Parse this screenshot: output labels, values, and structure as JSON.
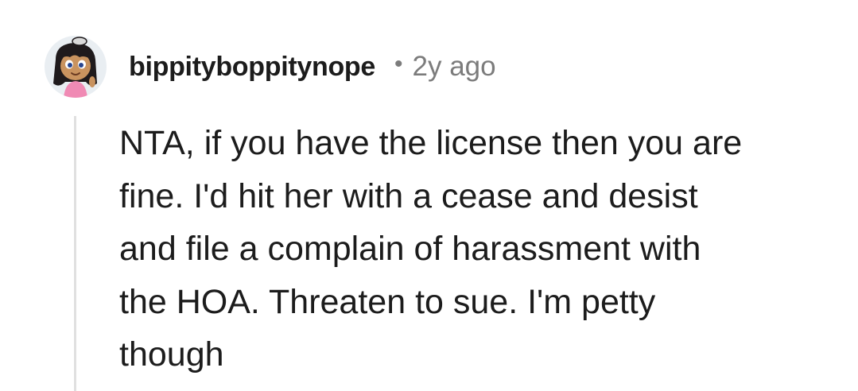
{
  "comment": {
    "author": "bippityboppitynope",
    "separator": "•",
    "timestamp": "2y ago",
    "avatar_icon": "cartoon-girl-avatar-icon",
    "body": "NTA, if you have the license then you are\nfine. I'd hit her with a cease and desist\nand file a complain of harassment with\nthe HOA. Threaten to sue. I'm petty\nthough"
  },
  "colors": {
    "text": "#1c1c1c",
    "muted": "#7c7c7c",
    "thread_line": "#e0e0e0",
    "avatar_bg": "#e9eef2"
  }
}
